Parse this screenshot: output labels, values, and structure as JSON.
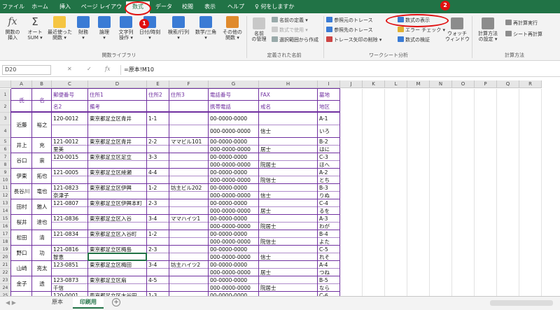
{
  "menu_tabs": [
    "ファイル",
    "ホーム",
    "挿入",
    "ページ レイアウト",
    "数式",
    "データ",
    "校閲",
    "表示",
    "ヘルプ",
    "何をしますか"
  ],
  "active_tab": "数式",
  "ribbon": {
    "library": {
      "insert_function": "関数の\n挿入",
      "autosum": "オート\nSUM ▾",
      "recent": "最近使った\n関数 ▾",
      "financial": "財務\n▾",
      "logical": "論理\n▾",
      "text": "文字列\n操作 ▾",
      "datetime": "日付/時刻\n▾",
      "lookup": "検索/行列\n▾",
      "math": "数学/三角\n▾",
      "more": "その他の\n関数 ▾",
      "group_label": "関数ライブラリ"
    },
    "names": {
      "name_manager": "名前\nの管理",
      "define_name": "名前の定義 ▾",
      "use_in_formula": "数式で使用 ▾",
      "create_from_selection": "選択範囲から作成",
      "group_label": "定義された名前"
    },
    "audit": {
      "trace_precedents": "参照元のトレース",
      "trace_dependents": "参照先のトレース",
      "remove_arrows": "トレース矢印の削除 ▾",
      "show_formulas": "数式の表示",
      "error_check": "エラー チェック ▾",
      "evaluate": "数式の検証",
      "watch_window": "ウォッチ\nウィンドウ",
      "group_label": "ワークシート分析"
    },
    "calc": {
      "options": "計算方法\nの設定 ▾",
      "calc_now": "再計算実行",
      "calc_sheet": "シート再計算",
      "group_label": "計算方法"
    }
  },
  "formula_bar": {
    "name_box": "D20",
    "cancel": "✕",
    "enter": "✓",
    "fx": "fx",
    "formula": "=原本!M10"
  },
  "columns": [
    "A",
    "B",
    "C",
    "D",
    "E",
    "F",
    "G",
    "H",
    "I",
    "J",
    "K",
    "L",
    "M",
    "N",
    "O",
    "P",
    "Q",
    "R"
  ],
  "row_numbers": [
    "1",
    "2",
    "3",
    "4",
    "5",
    "6",
    "7",
    "8",
    "9",
    "10",
    "11",
    "12",
    "13",
    "14",
    "15",
    "16",
    "17",
    "18",
    "19",
    "20",
    "21",
    "22",
    "23",
    "24",
    "25",
    "26",
    "27",
    "28"
  ],
  "header_rows": {
    "shi": "氏",
    "mei": "名",
    "row1": [
      "郵便番号",
      "住所1",
      "住所2",
      "住所3",
      "電話番号",
      "FAX",
      "墓地"
    ],
    "row2": [
      "名2",
      "備考",
      "携帯電話",
      "戒名",
      "地区"
    ]
  },
  "records": [
    {
      "shi": "近藤",
      "mei": "裕之",
      "zip": "120-0012",
      "addr1": "東京都足立区青井",
      "addr2": "1-1",
      "addr3": "",
      "tel": "00-0000-0000",
      "bochi": "A-1",
      "note": "",
      "mobile": "000-0000-0000",
      "kaimyo": "信士",
      "chiku": "いろ"
    },
    {
      "shi": "井上",
      "mei": "充",
      "zip": "121-0012",
      "addr1": "東京都足立区青井",
      "addr2": "2-2",
      "addr3": "ママビル101",
      "tel": "00-0000-0000",
      "bochi": "B-2",
      "note": "里美",
      "mobile": "000-0000-0000",
      "kaimyo": "居士",
      "chiku": "はに"
    },
    {
      "shi": "谷口",
      "mei": "崇",
      "zip": "120-0015",
      "addr1": "東京都足立区足立",
      "addr2": "3-3",
      "addr3": "",
      "tel": "00-0000-0000",
      "bochi": "C-3",
      "note": "",
      "mobile": "000-0000-0000",
      "kaimyo": "院居士",
      "chiku": "ほへ"
    },
    {
      "shi": "伊東",
      "mei": "拓也",
      "zip": "121-0005",
      "addr1": "東京都足立区綾瀬",
      "addr2": "4-4",
      "addr3": "",
      "tel": "00-0000-0000",
      "bochi": "A-2",
      "note": "",
      "mobile": "000-0000-0000",
      "kaimyo": "院信士",
      "chiku": "とち"
    },
    {
      "shi": "長谷川",
      "mei": "竜也",
      "zip": "121-0823",
      "addr1": "東京都足立区伊興",
      "addr2": "1-2",
      "addr3": "坊主ビル202",
      "tel": "00-0000-0000",
      "bochi": "B-3",
      "note": "奈津子",
      "mobile": "000-0000-0000",
      "kaimyo": "信士",
      "chiku": "りぬ"
    },
    {
      "shi": "田村",
      "mei": "雅人",
      "zip": "121-0807",
      "addr1": "東京都足立区伊興本町",
      "addr2": "2-3",
      "addr3": "",
      "tel": "00-0000-0000",
      "bochi": "C-4",
      "note": "",
      "mobile": "000-0000-0000",
      "kaimyo": "居士",
      "chiku": "るを"
    },
    {
      "shi": "桜井",
      "mei": "達也",
      "zip": "121-0836",
      "addr1": "東京都足立区入谷",
      "addr2": "3-4",
      "addr3": "ママハイツ1",
      "tel": "00-0000-0000",
      "bochi": "A-3",
      "note": "",
      "mobile": "000-0000-0000",
      "kaimyo": "院居士",
      "chiku": "わが"
    },
    {
      "shi": "松田",
      "mei": "清",
      "zip": "121-0834",
      "addr1": "東京都足立区入谷町",
      "addr2": "1-2",
      "addr3": "",
      "tel": "00-0000-0000",
      "bochi": "B-4",
      "note": "",
      "mobile": "000-0000-0000",
      "kaimyo": "院信士",
      "chiku": "よた"
    },
    {
      "shi": "野口",
      "mei": "功",
      "zip": "121-0816",
      "addr1": "東京都足立区梅島",
      "addr2": "2-3",
      "addr3": "",
      "tel": "00-0000-0000",
      "bochi": "C-5",
      "note": "智恵",
      "mobile": "000-0000-0000",
      "kaimyo": "信士",
      "chiku": "れそ"
    },
    {
      "shi": "山崎",
      "mei": "亮太",
      "zip": "123-0851",
      "addr1": "東京都足立区梅田",
      "addr2": "3-4",
      "addr3": "坊主ハイツ2",
      "tel": "00-0000-0000",
      "bochi": "A-4",
      "note": "",
      "mobile": "000-0000-0000",
      "kaimyo": "居士",
      "chiku": "つね"
    },
    {
      "shi": "金子",
      "mei": "透",
      "zip": "123-0873",
      "addr1": "東京都足立区扇",
      "addr2": "4-5",
      "addr3": "",
      "tel": "00-0000-0000",
      "bochi": "B-5",
      "note": "千信",
      "mobile": "000-0000-0000",
      "kaimyo": "院居士",
      "chiku": "なら"
    },
    {
      "shi": "",
      "mei": "",
      "zip": "120-0001",
      "addr1": "東京都足立区大谷田",
      "addr2": "1-3",
      "addr3": "",
      "tel": "00-0000-0000",
      "bochi": "C-6",
      "note": "",
      "mobile": "",
      "kaimyo": "",
      "chiku": ""
    }
  ],
  "partial_name": {
    "shi": "恵",
    "mei": "一成"
  },
  "sheets": [
    "原本",
    "印刷用"
  ],
  "active_sheet": "印刷用",
  "sheet_nav": "◀ ▶",
  "add_sheet": "+",
  "annotations": [
    {
      "number": "1"
    },
    {
      "number": "2"
    }
  ],
  "colors": {
    "excel_green": "#217346",
    "accent_purple": "#7030a0",
    "annotation_red": "#e01010"
  }
}
